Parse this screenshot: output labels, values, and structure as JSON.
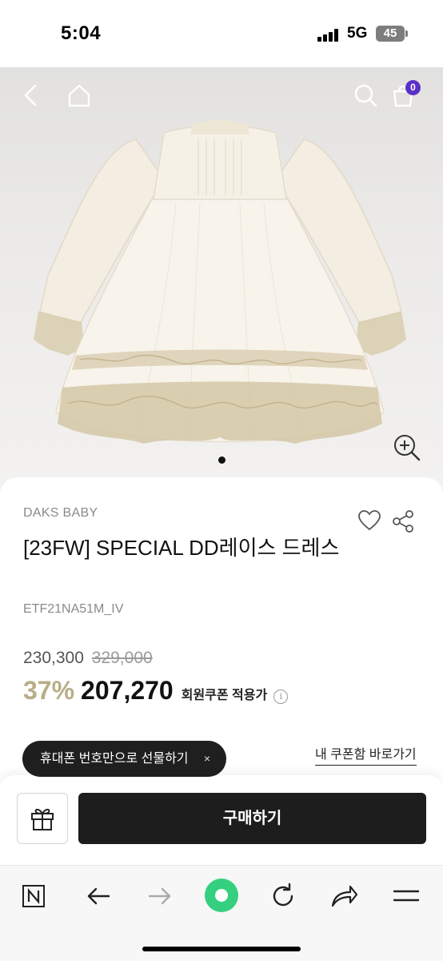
{
  "status_bar": {
    "time": "5:04",
    "network": "5G",
    "battery": "45"
  },
  "hero": {
    "cart_count": "0",
    "icons": [
      "back-icon",
      "home-icon",
      "search-icon",
      "shopping-bag-icon",
      "zoom-in-icon"
    ],
    "carousel_pages": 1
  },
  "product": {
    "brand": "DAKS BABY",
    "title": "[23FW] SPECIAL DD레이스 드레스",
    "sku": "ETF21NA51M_IV",
    "price": "230,300",
    "original_price": "329,000",
    "discount": "37%",
    "member_price": "207,270",
    "member_label": "회원쿠폰 적용가",
    "coupon_link": "내 쿠폰함 바로가기"
  },
  "gift_toast": {
    "label": "휴대폰 번호만으로 선물하기",
    "close": "×"
  },
  "buy_bar": {
    "buy_label": "구매하기"
  },
  "browser_toolbar": {
    "icons": [
      "naver-n-icon",
      "back-arrow-icon",
      "forward-arrow-icon",
      "green-dot-icon",
      "reload-icon",
      "share-arrow-icon",
      "menu-icon"
    ]
  },
  "colors": {
    "discount": "#b8ad85",
    "cart_badge": "#5a31c8",
    "buy_button": "#1d1d1d",
    "browser_green": "#35d07f"
  }
}
